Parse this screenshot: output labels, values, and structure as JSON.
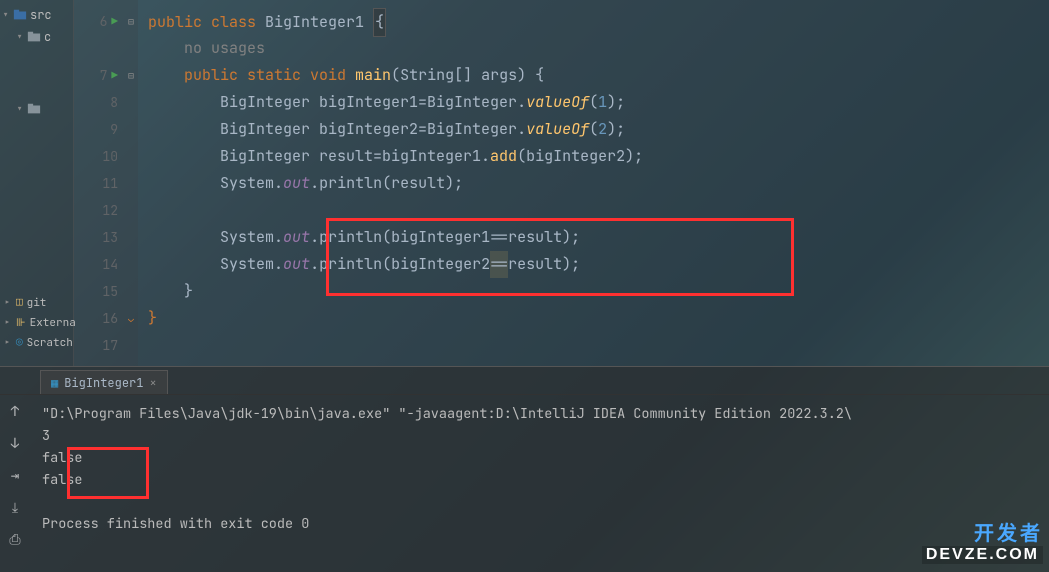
{
  "project": {
    "src_label": "src",
    "folder2_label": "c",
    "git_label": "git",
    "external_label": "Externa",
    "scratch_label": "Scratch"
  },
  "editor": {
    "lines": {
      "l1": {
        "num": "6",
        "pre": "",
        "tokens": "public class BigInteger1 {"
      },
      "l2": {
        "num": "",
        "usages": "no usages"
      },
      "l3": {
        "num": "7",
        "tokens": "public static void main(String[] args) {"
      },
      "l4": {
        "num": "8",
        "tokens": "BigInteger bigInteger1=BigInteger.valueOf(1);"
      },
      "l5": {
        "num": "9",
        "tokens": "BigInteger bigInteger2=BigInteger.valueOf(2);"
      },
      "l6": {
        "num": "10",
        "tokens": "BigInteger result=bigInteger1.add(bigInteger2);"
      },
      "l7": {
        "num": "11",
        "tokens": "System.out.println(result);"
      },
      "l8": {
        "num": "12",
        "tokens": ""
      },
      "l9": {
        "num": "13",
        "tokens": "System.out.println(bigInteger1==result);"
      },
      "l10": {
        "num": "14",
        "tokens": "System.out.println(bigInteger2==result);"
      },
      "l11": {
        "num": "15",
        "tokens": "}"
      },
      "l12": {
        "num": "16",
        "tokens": "}"
      },
      "l13": {
        "num": "17",
        "tokens": ""
      }
    }
  },
  "run": {
    "tab_label": "BigInteger1",
    "cmd": "\"D:\\Program Files\\Java\\jdk-19\\bin\\java.exe\" \"-javaagent:D:\\IntelliJ IDEA Community Edition 2022.3.2\\",
    "out1": "3",
    "out2": "false",
    "out3": "false",
    "exit": "Process finished with exit code 0"
  },
  "watermark": {
    "line1": "开发者",
    "line2": "DEVZE.COM"
  }
}
